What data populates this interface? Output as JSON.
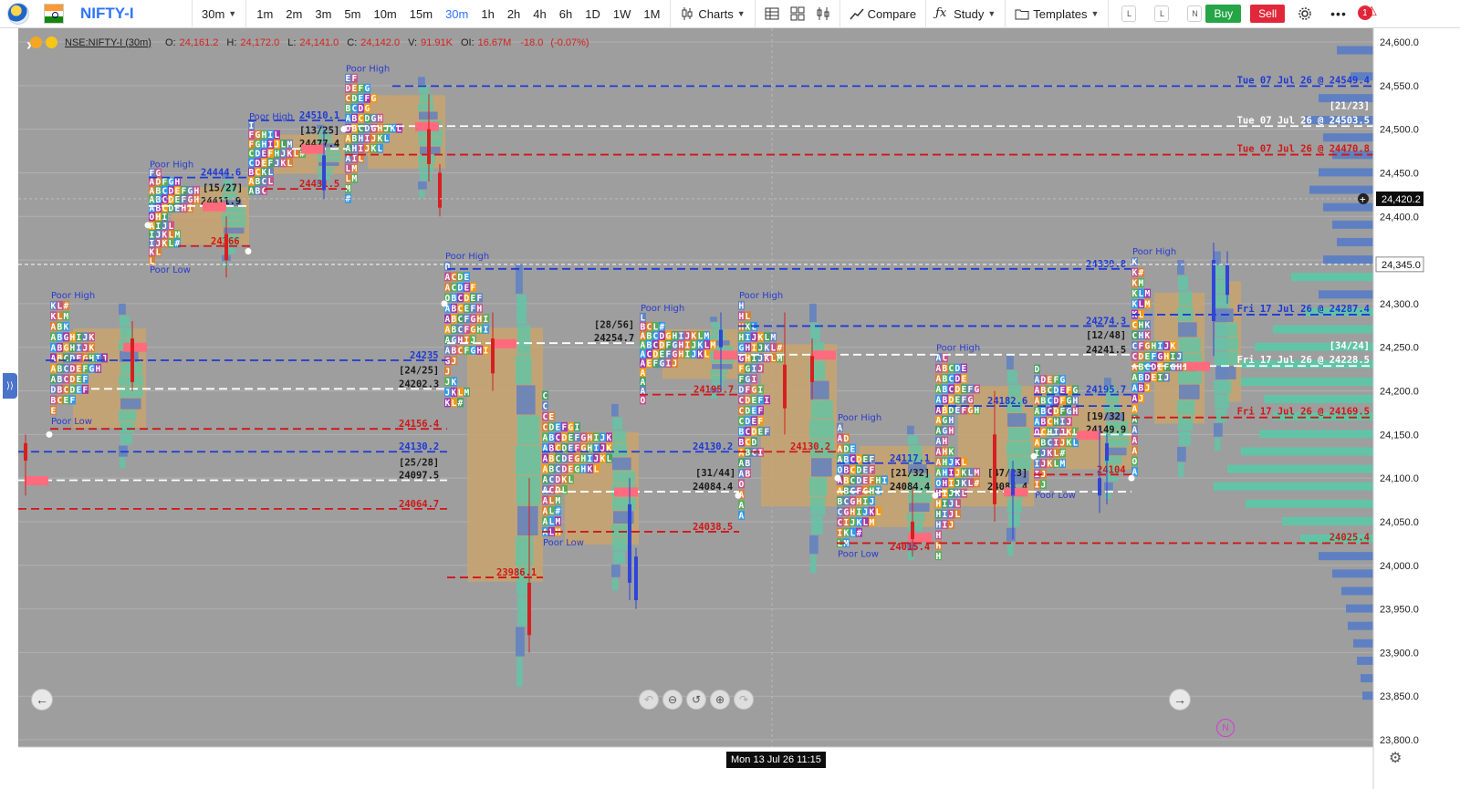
{
  "toolbar": {
    "symbol": "NIFTY-I",
    "interval_selected": "30m",
    "intervals": [
      "1m",
      "2m",
      "3m",
      "5m",
      "10m",
      "15m",
      "30m",
      "1h",
      "2h",
      "4h",
      "6h",
      "1D",
      "1W",
      "1M"
    ],
    "active_interval": "30m",
    "charts_label": "Charts",
    "compare_label": "Compare",
    "study_label": "Study",
    "templates_label": "Templates",
    "l1": "L",
    "l2": "L",
    "n": "N",
    "buy_label": "Buy",
    "sell_label": "Sell",
    "alert_count": "1"
  },
  "legend": {
    "symbol": "NSE:NIFTY-I (30m)",
    "o_key": "O:",
    "o": "24,161.2",
    "h_key": "H:",
    "h": "24,172.0",
    "l_key": "L:",
    "l": "24,141.0",
    "c_key": "C:",
    "c": "24,142.0",
    "vol_key": "V:",
    "vol": "91.91K",
    "oi_key": "OI:",
    "oi": "16.67M",
    "chg": "-18.0",
    "chg_pct": "(-0.07%)"
  },
  "price_axis": {
    "ticks": [
      24600,
      24550,
      24500,
      24450,
      24400,
      24350,
      24300,
      24250,
      24200,
      24150,
      24100,
      24050,
      24000,
      23950,
      23900,
      23850,
      23800
    ],
    "current_price": "24,345.0",
    "crosshair_price": "24,420.2"
  },
  "crosshair_time": "Mon 13 Jul 26 11:15",
  "colors": {
    "background": "#9e9e9e",
    "poc_blue": "#1f3ad6",
    "poc_white": "#ffffff",
    "poc_red": "#d11717",
    "value_area": "#c8a36f",
    "profile_blue": "#5b7ec4",
    "profile_green": "#5fc6a6",
    "bull": "#2f45d8",
    "bear": "#d81f1f"
  },
  "sessions": [
    {
      "id": "s1",
      "poc_high": "24130.2",
      "poc": "24097.5",
      "poc_low": "24064.7",
      "ratio": "[25/28]",
      "tpo": [
        "Poor High",
        "KL#",
        "KLM",
        "ABK",
        "ABGHIJK",
        "ABGHIJK",
        "ABCDFGHIJ",
        "ABCDEFGH",
        "ABCDEF",
        "DBCDEF",
        "BCEF",
        "E",
        "Poor Low"
      ]
    },
    {
      "id": "s2",
      "poc_high": "24444.6",
      "poc": "24411.9",
      "poc_low": "24366",
      "ratio": "[15/27]",
      "tpo": [
        "Poor High",
        "FG",
        "ADFGH",
        "ABCDEFGH",
        "ABCDEFGH",
        "ABCDEHI",
        "OHI",
        "AIJL",
        "IJKLM",
        "IJKL#",
        "KL",
        "L",
        "Poor Low"
      ]
    },
    {
      "id": "s3",
      "poc_high": "24510.1",
      "poc": "24477.4",
      "poc_low": "24431.5",
      "ratio": "[13/25]",
      "tpo": [
        "Poor High",
        "I",
        "FGHIL",
        "FGHIJLM",
        "CDEFHJKL#",
        "CDEFJKL",
        "BCKL",
        "ABCL",
        "ABC"
      ]
    },
    {
      "id": "s4",
      "poc_high": "",
      "poc": "",
      "poc_low": "",
      "ratio": "",
      "tpo": [
        "Poor High",
        "EF",
        "DEFG",
        "CDEFG",
        "BCDG",
        "ABCDGH",
        "OBCDGHJKL",
        "ABHIJKL",
        "AHIJKL",
        "AIL",
        "LM",
        "LM",
        "M",
        "#"
      ]
    },
    {
      "id": "s5",
      "poc_high": "24235",
      "poc": "24202.3",
      "poc_low": "24156.4",
      "ratio": "[24/25]",
      "tpo": [
        "Poor High",
        "D",
        "ACDE",
        "ACDEF",
        "OBCDEF",
        "ABCEFH",
        "ABCFGHI",
        "ABCFGHI",
        "AGHIJ",
        "ABCFGHI",
        "GJ",
        "J",
        "JK",
        "JKLM",
        "KL#"
      ]
    },
    {
      "id": "s6",
      "poc_high": "24254.7",
      "poc": "",
      "poc_low": "23986.1",
      "ratio": "[28/56]",
      "tpo": [
        "C",
        "C",
        "CE",
        "CDEFGI",
        "ABCDEFGHIJK",
        "ABCDEFGHIJK",
        "ABCDEGHIJKL",
        "ABCDEGHKL",
        "ACDKL",
        "ACDL",
        "ALM",
        "AL#",
        "ALM",
        "ALM",
        "Poor Low"
      ]
    },
    {
      "id": "s7",
      "poc_high": "24195.7",
      "poc": "24084.4",
      "poc_low": "24038.5",
      "ratio": "[31/44]",
      "tpo": [
        "Poor High",
        "L",
        "BCL#",
        "ABCDGHIJKLM",
        "ABCDFGHIJKLM",
        "ACDEFGHIJKL",
        "AEFGIJ",
        "A",
        "A",
        "A",
        "O"
      ]
    },
    {
      "id": "s8",
      "poc_high": "24130.2",
      "poc": "",
      "poc_low": "",
      "ratio": "",
      "tpo": [
        "Poor High",
        "H",
        "HL",
        "HKL",
        "HIJKLM",
        "GHIJKL#",
        "GHIJKLM",
        "FGIJ",
        "FGI",
        "DFGI",
        "CDEFI",
        "CDEF",
        "CDEF",
        "BCDEF",
        "BCD",
        "ABCI",
        "AB",
        "AB",
        "O",
        "A",
        "A",
        "A"
      ]
    },
    {
      "id": "s9",
      "poc_high": "24117.1",
      "poc": "24084.4",
      "poc_low": "24015.4",
      "ratio": "[21/32]",
      "tpo": [
        "Poor High",
        "A",
        "AD",
        "ADE",
        "ABCDEF",
        "OBCDEF",
        "ABCDEFHI",
        "ABCFGHI",
        "BCGHIJ",
        "CGHIJKL",
        "CIJKLM",
        "IKL#",
        "LM",
        "Poor Low"
      ]
    },
    {
      "id": "s10",
      "poc_high": "24182.6",
      "poc": "24084.4",
      "poc_low": "",
      "ratio": "[47/23]",
      "tpo": [
        "Poor High",
        "AC",
        "ABCDE",
        "ABCDE",
        "ABCDEFG",
        "ABDEFG",
        "ABDEFGH",
        "AGH",
        "AGH",
        "AH",
        "AHK",
        "AHJKL",
        "AHIJKLM",
        "OHIJKL#",
        "HIJKL",
        "HIJL",
        "HIJL",
        "HIJ",
        "H",
        "H",
        "H"
      ]
    },
    {
      "id": "s11",
      "poc_high": "24195.7",
      "poc": "24149.9",
      "poc_low": "24104",
      "ratio": "[19/32]",
      "tpo": [
        "D",
        "ADEFG",
        "ABCDEFG",
        "ABCDFGH",
        "ABCDFGH",
        "ABCHIJ",
        "OCHIJKL",
        "ABCIJKL",
        "IJKL#",
        "IJKLM",
        "IJ",
        "IJ",
        "Poor Low"
      ]
    },
    {
      "id": "s12",
      "poc_high": "24339.8",
      "poc": "24241.5",
      "poc_low": "24169.5",
      "ratio": "[12/48]",
      "tpo": [
        "Poor High",
        "K",
        "K#",
        "KM",
        "KLM",
        "KLM",
        "KL",
        "CHK",
        "CHK",
        "CFGHIJK",
        "CDEFGHIJ",
        "ABCDEFGHIJ",
        "ABDEIJ",
        "ABJ",
        "AJ",
        "A",
        "A",
        "A",
        "A",
        "A",
        "O",
        "A"
      ]
    },
    {
      "id": "s13",
      "poc_high": "24287.4",
      "poc": "24228.5",
      "poc_low": "24169.5",
      "ratio": "[34/24]",
      "tpo": []
    }
  ],
  "right_levels": [
    {
      "text": "Tue 07 Jul 26 @ 24549.4",
      "price": 24549.4,
      "color": "#1f3ad6"
    },
    {
      "text": "Tue 07 Jul 26 @ 24503.5",
      "price": 24503.5,
      "color": "#ffffff"
    },
    {
      "text": "Tue 07 Jul 26 @ 24470.8",
      "price": 24470.8,
      "color": "#d11717"
    },
    {
      "text": "Fri 17 Jul 26 @ 24287.4",
      "price": 24287.4,
      "color": "#1f3ad6"
    },
    {
      "text": "Fri 17 Jul 26 @ 24228.5",
      "price": 24228.5,
      "color": "#ffffff"
    },
    {
      "text": "Fri 17 Jul 26 @ 24169.5",
      "price": 24169.5,
      "color": "#d11717"
    },
    {
      "text": "24025.4",
      "price": 24025.4,
      "color": "#d11717"
    }
  ],
  "right_ratio_1": "[21/23]",
  "right_ratio_2": "[34/24]",
  "n_badge": "N"
}
